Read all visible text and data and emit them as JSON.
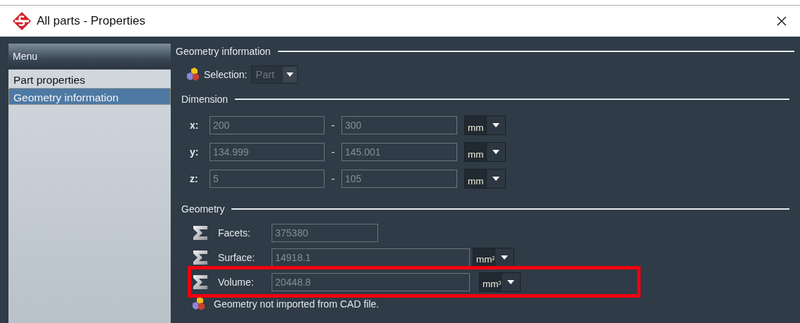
{
  "window": {
    "title": "All parts - Properties"
  },
  "sidebar": {
    "header": "Menu",
    "items": [
      {
        "label": "Part properties",
        "selected": false
      },
      {
        "label": "Geometry information",
        "selected": true
      }
    ]
  },
  "section_title": "Geometry information",
  "selection": {
    "label": "Selection:",
    "value": "Part",
    "disabled": true
  },
  "dimension": {
    "title": "Dimension",
    "rows": [
      {
        "axis": "x:",
        "min": "200",
        "separator": "-",
        "max": "300",
        "unit": "mm"
      },
      {
        "axis": "y:",
        "min": "134.999",
        "separator": "-",
        "max": "145.001",
        "unit": "mm"
      },
      {
        "axis": "z:",
        "min": "5",
        "separator": "-",
        "max": "105",
        "unit": "mm"
      }
    ]
  },
  "geometry": {
    "title": "Geometry",
    "rows": [
      {
        "label": "Facets:",
        "value": "375380",
        "highlighted": false
      },
      {
        "label": "Surface:",
        "value": "14918.1",
        "unit": "mm²",
        "highlighted": false
      },
      {
        "label": "Volume:",
        "value": "20448.8",
        "unit": "mm³",
        "highlighted": true
      }
    ]
  },
  "notice": "Geometry not imported from CAD file."
}
